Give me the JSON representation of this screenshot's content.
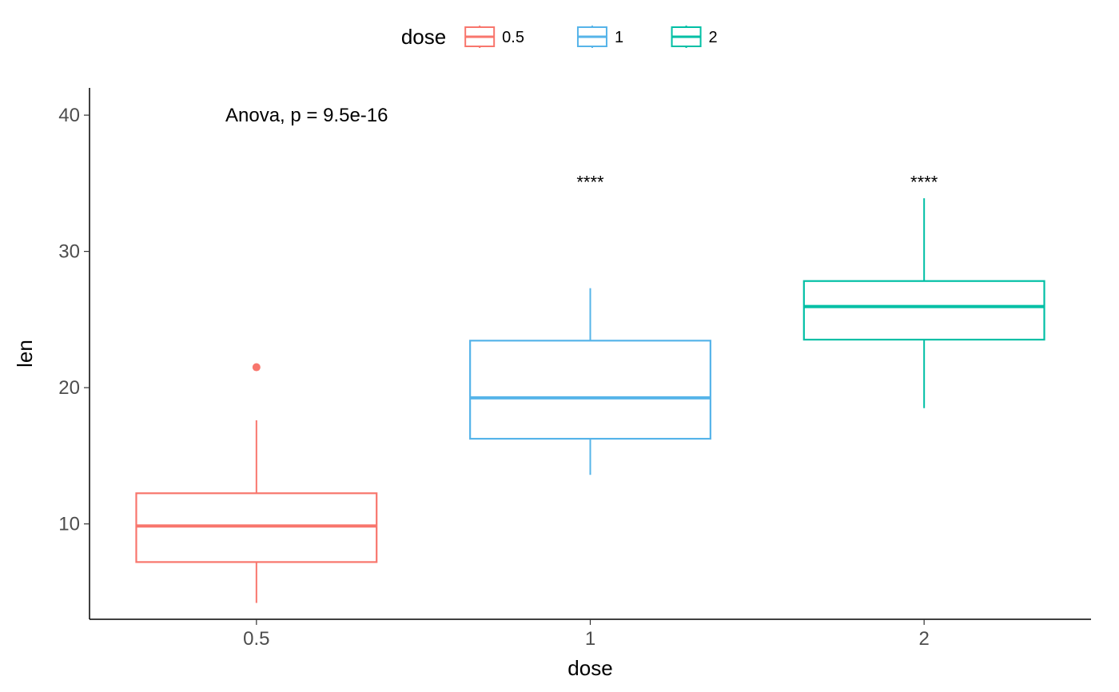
{
  "chart_data": {
    "type": "boxplot",
    "xlabel": "dose",
    "ylabel": "len",
    "x_categories": [
      "0.5",
      "1",
      "2"
    ],
    "y_ticks": [
      10,
      20,
      30,
      40
    ],
    "ylim": [
      3,
      42
    ],
    "legend": {
      "title": "dose",
      "items": [
        "0.5",
        "1",
        "2"
      ]
    },
    "colors": {
      "0.5": "#F8766D",
      "1": "#56B4E9",
      "2": "#00BFA5"
    },
    "annotation": "Anova, p = 9.5e-16",
    "series": [
      {
        "name": "0.5",
        "lower_whisker": 4.2,
        "q1": 7.2,
        "median": 9.85,
        "q3": 12.25,
        "upper_whisker": 17.6,
        "outliers": [
          21.5
        ],
        "sig_label": "",
        "sig_y": null
      },
      {
        "name": "1",
        "lower_whisker": 13.6,
        "q1": 16.25,
        "median": 19.25,
        "q3": 23.45,
        "upper_whisker": 27.3,
        "outliers": [],
        "sig_label": "****",
        "sig_y": 35
      },
      {
        "name": "2",
        "lower_whisker": 18.5,
        "q1": 23.525,
        "median": 25.95,
        "q3": 27.825,
        "upper_whisker": 33.9,
        "outliers": [],
        "sig_label": "****",
        "sig_y": 35
      }
    ]
  }
}
